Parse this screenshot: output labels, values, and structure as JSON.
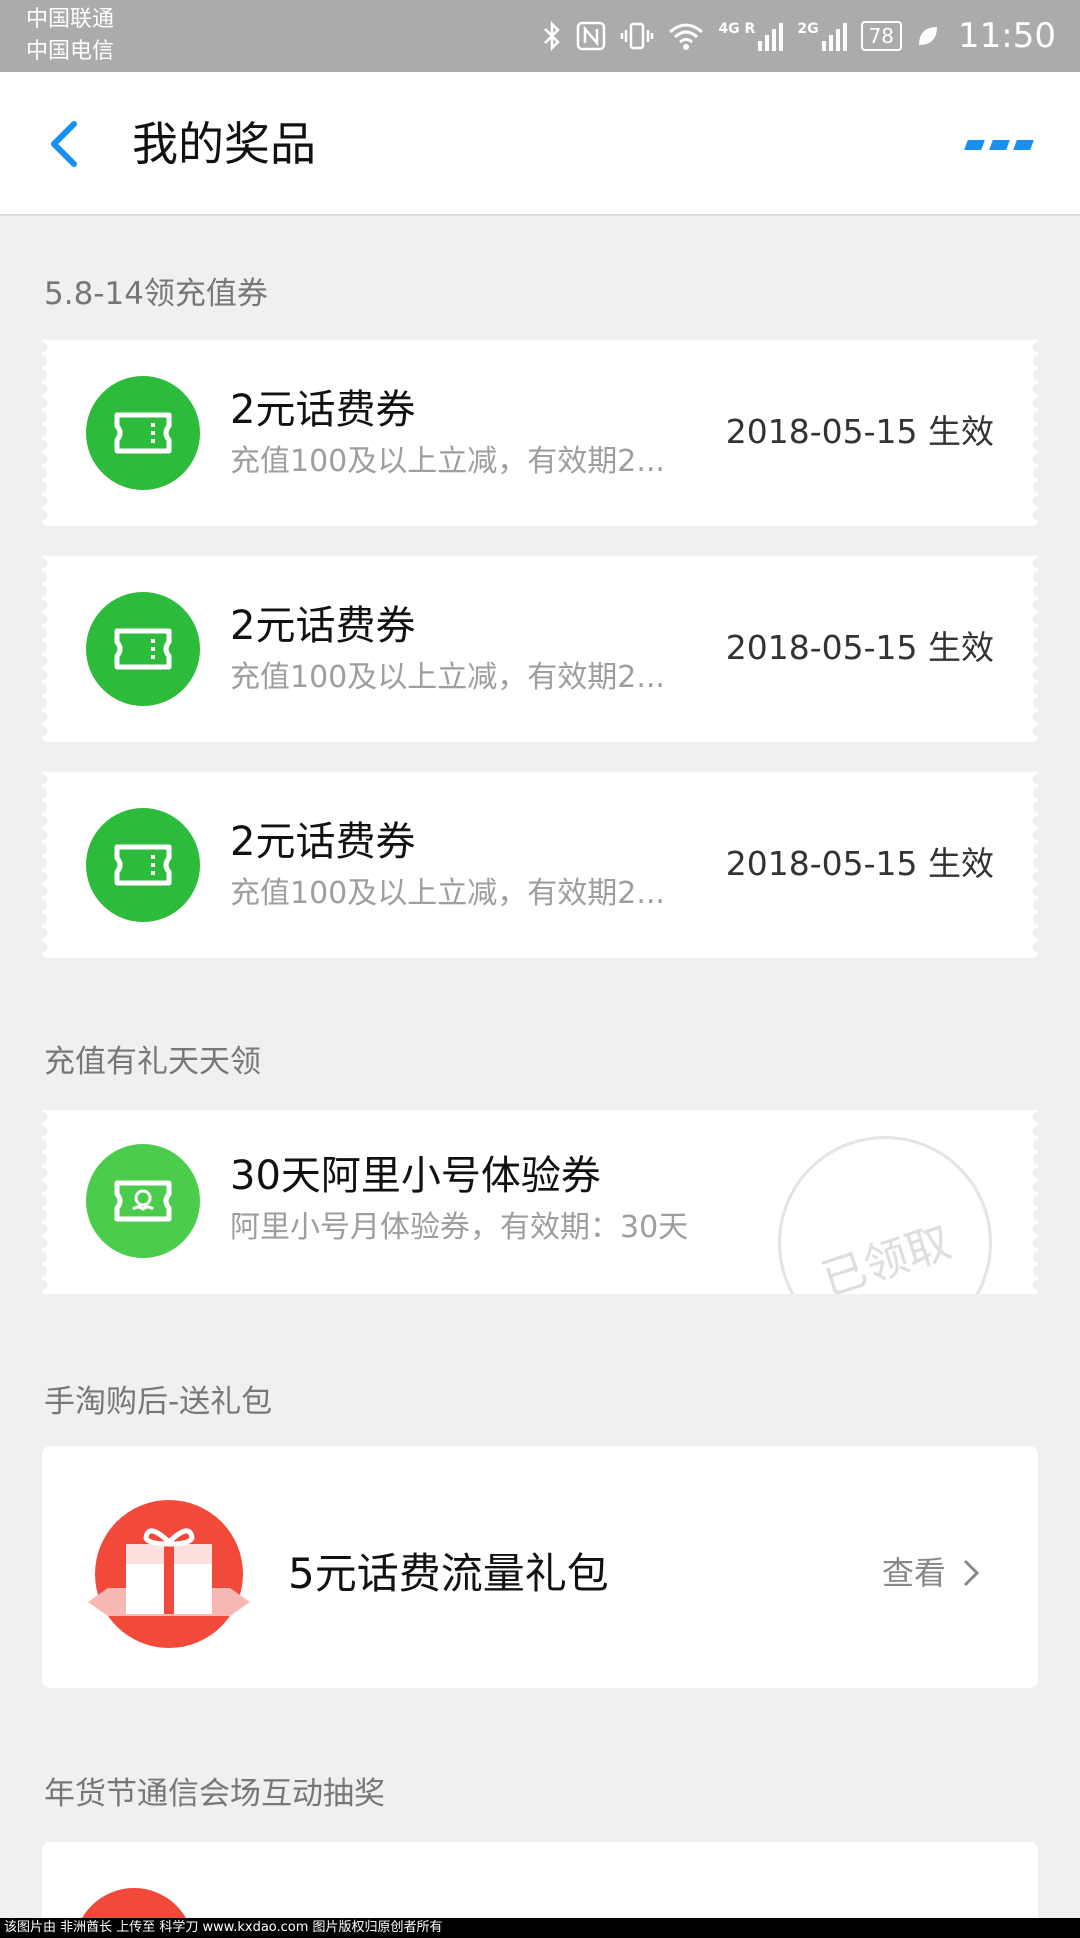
{
  "status_bar": {
    "carrier_1": "中国联通",
    "carrier_2": "中国电信",
    "sim1_type": "4G R",
    "sim2_type": "2G",
    "battery": "78",
    "time": "11:50",
    "icons": [
      "bluetooth-icon",
      "nfc-icon",
      "vibrate-icon",
      "wifi-icon",
      "signal-icon",
      "battery-icon",
      "leaf-icon"
    ]
  },
  "nav": {
    "title": "我的奖品",
    "back_icon": "chevron-left-icon",
    "more_icon": "more-dots-icon",
    "accent_color": "#1a8ff0"
  },
  "sections": [
    {
      "title": "5.8-14领充值券",
      "items": [
        {
          "title": "2元话费券",
          "desc": "充值100及以上立减，有效期2...",
          "date": "2018-05-15 生效",
          "icon": "ticket-icon"
        },
        {
          "title": "2元话费券",
          "desc": "充值100及以上立减，有效期2...",
          "date": "2018-05-15 生效",
          "icon": "ticket-icon"
        },
        {
          "title": "2元话费券",
          "desc": "充值100及以上立减，有效期2...",
          "date": "2018-05-15 生效",
          "icon": "ticket-icon"
        }
      ]
    },
    {
      "title": "充值有礼天天领",
      "items": [
        {
          "title": "30天阿里小号体验券",
          "desc": "阿里小号月体验券，有效期：30天",
          "stamp": "已领取",
          "icon": "ticket-face-icon"
        }
      ]
    },
    {
      "title": "手淘购后-送礼包",
      "items": [
        {
          "title": "5元话费流量礼包",
          "link": "查看",
          "icon": "gift-icon"
        }
      ]
    },
    {
      "title": "年货节通信会场互动抽奖"
    }
  ],
  "colors": {
    "green": "#2dbb3b",
    "red": "#f24a3a",
    "background": "#f0f0f0"
  },
  "footer": "该图片由 非洲酋长 上传至 科学刀 www.kxdao.com 图片版权归原创者所有"
}
